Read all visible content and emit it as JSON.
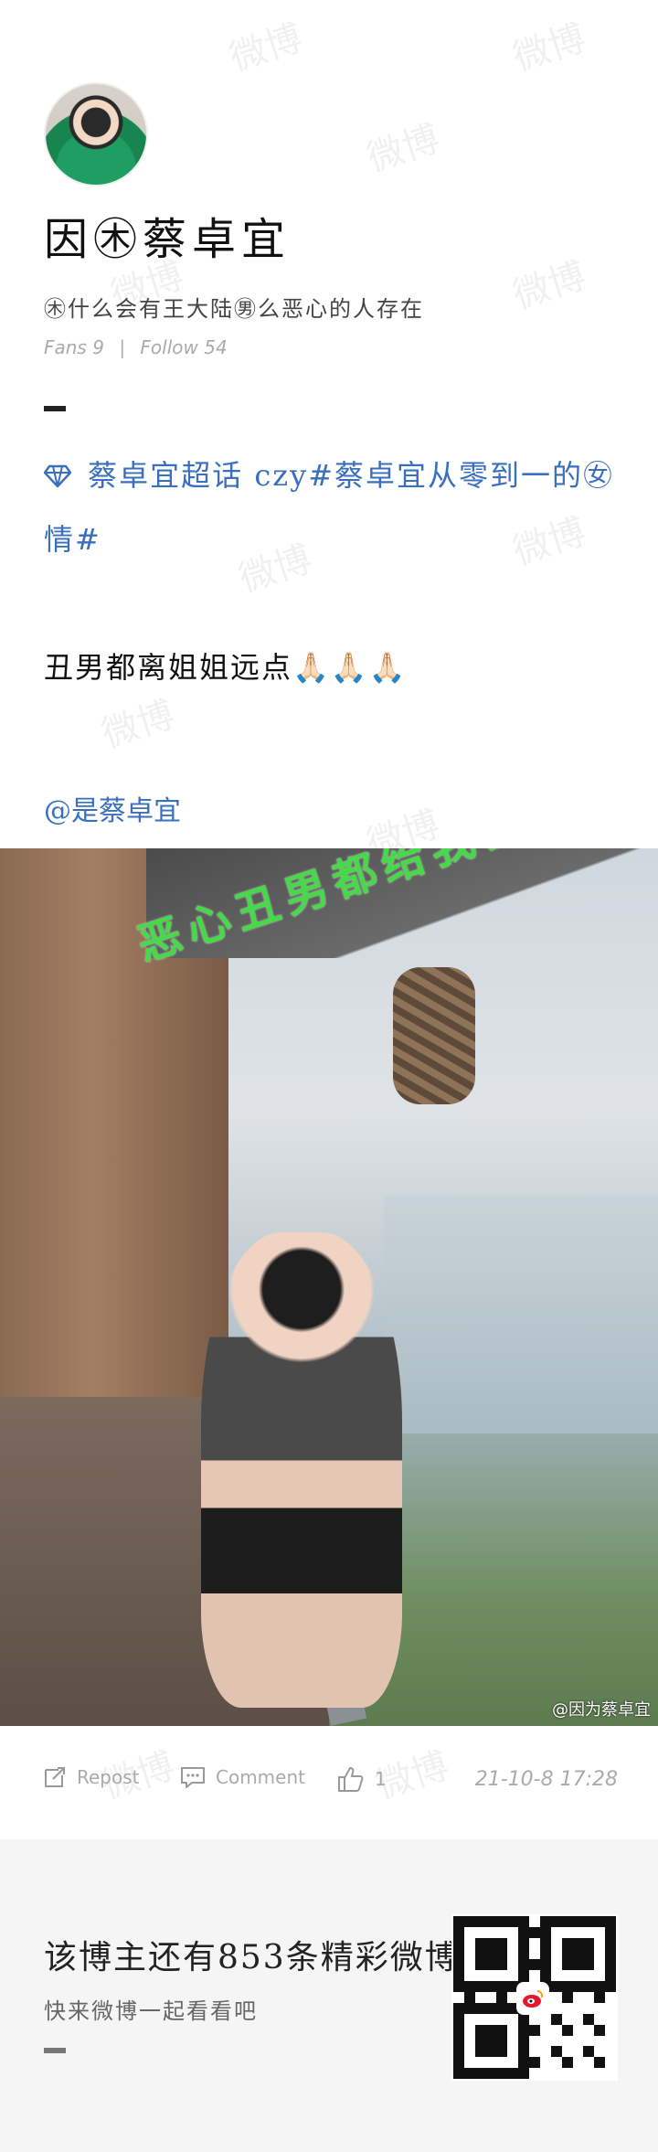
{
  "profile": {
    "name": "因㊍蔡卓宜",
    "bio": "㊍什么会有王大陆㊚么恶心的人存在",
    "fans_label": "Fans",
    "fans_count": "9",
    "follow_label": "Follow",
    "follow_count": "54"
  },
  "post": {
    "topic_icon": "gem-icon",
    "topic_text": "蔡卓宜超话 czy#蔡卓宜从零到一的㊛情#",
    "body_text": "丑男都离姐姐远点",
    "emoji": "🙏🏻🙏🏻🙏🏻",
    "mention": "@是蔡卓宜",
    "image_overlay_text": "恶心丑男都给我去死",
    "image_watermark": "@因为蔡卓宜"
  },
  "actions": {
    "repost_label": "Repost",
    "comment_label": "Comment",
    "like_count": "1",
    "timestamp": "21-10-8  17:28"
  },
  "footer": {
    "headline": "该博主还有853条精彩微博",
    "subline": "快来微博一起看看吧"
  },
  "watermark_text": "微博"
}
